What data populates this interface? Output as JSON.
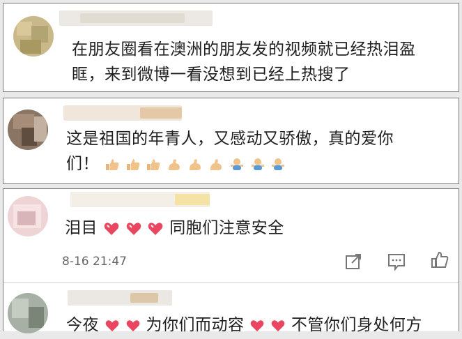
{
  "comments": [
    {
      "text_line1": "在朋友圈看在澳洲的朋友发的视频就已经热泪盈",
      "text_line2": "眶，来到微博一看没想到已经上热搜了"
    },
    {
      "text_line1": "这是祖国的年青人，又感动又骄傲，真的爱你",
      "text_line2": "们！"
    },
    {
      "text_prefix": "泪目",
      "text_suffix": "同胞们注意安全",
      "time": "8-16 21:47"
    },
    {
      "text_a": "今夜",
      "text_b": "为你们而动容",
      "text_c": "不管你们身处何方"
    }
  ],
  "icons": {
    "share": "share-icon",
    "comment": "comment-icon",
    "like": "thumbs-up-icon"
  },
  "colors": {
    "heart": "#e8475f",
    "thumb": "#f0c38b",
    "blue_figure": "#5b9bd5"
  }
}
